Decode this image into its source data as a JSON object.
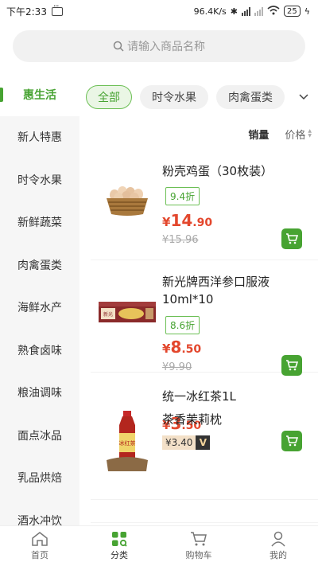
{
  "status_bar": {
    "time": "下午2:33",
    "network_speed": "96.4K/s",
    "battery": "25"
  },
  "search": {
    "placeholder": "请输入商品名称"
  },
  "sidebar": {
    "items": [
      {
        "label": "惠生活",
        "active": true
      },
      {
        "label": "新人特惠"
      },
      {
        "label": "时令水果"
      },
      {
        "label": "新鲜蔬菜"
      },
      {
        "label": "肉禽蛋类"
      },
      {
        "label": "海鲜水产"
      },
      {
        "label": "熟食卤味"
      },
      {
        "label": "粮油调味"
      },
      {
        "label": "面点冰品"
      },
      {
        "label": "乳品烘焙"
      },
      {
        "label": "酒水冲饮"
      }
    ]
  },
  "tabs": {
    "items": [
      "全部",
      "时令水果",
      "肉禽蛋类"
    ],
    "active": "全部"
  },
  "sort": {
    "sales": "销量",
    "price": "价格"
  },
  "products": [
    {
      "name": "粉壳鸡蛋（30枚装）",
      "discount": "9.4折",
      "currency": "¥",
      "price_int": "14",
      "price_dec": ".90",
      "original_price": "¥15.96",
      "image": "egg-basket"
    },
    {
      "name": "新光牌西洋参口服液10ml*10",
      "discount": "8.6折",
      "currency": "¥",
      "price_int": "8",
      "price_dec": ".50",
      "original_price": "¥9.90",
      "image": "ginseng-box"
    },
    {
      "name": "统一冰红茶1L",
      "currency": "¥",
      "price_int": "3",
      "price_dec": ".50",
      "vip_price": "¥3.40",
      "vip_badge": "V",
      "image": "tea-bottle"
    },
    {
      "name": "茶香茉莉枕",
      "image": "pillow"
    }
  ],
  "bottom_nav": [
    {
      "label": "首页",
      "icon": "home-icon"
    },
    {
      "label": "分类",
      "icon": "category-icon",
      "active": true
    },
    {
      "label": "购物车",
      "icon": "cart-icon"
    },
    {
      "label": "我的",
      "icon": "user-icon"
    }
  ],
  "colors": {
    "accent": "#47a332",
    "price": "#e3472d"
  }
}
